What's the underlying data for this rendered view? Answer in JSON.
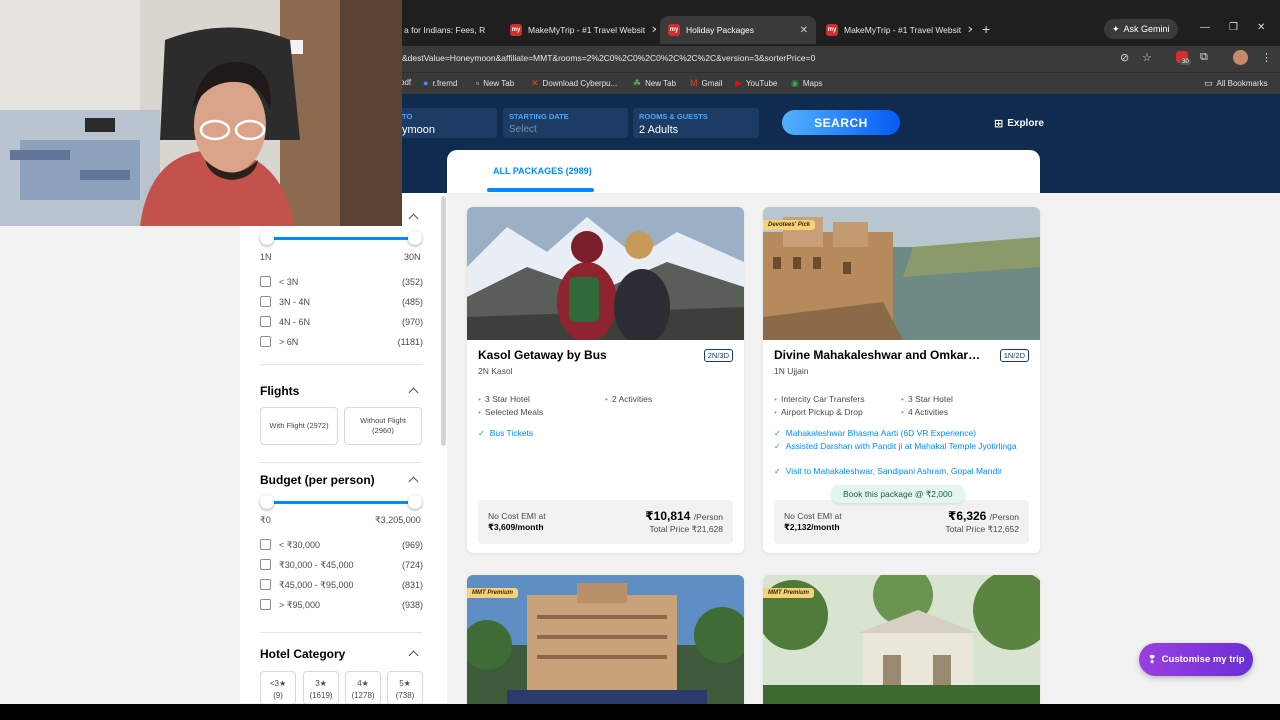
{
  "browser": {
    "tabs": [
      {
        "title": "a for Indians: Fees, R",
        "active": false
      },
      {
        "title": "MakeMyTrip - #1 Travel Websit",
        "active": false
      },
      {
        "title": "Holiday Packages",
        "active": true
      },
      {
        "title": "MakeMyTrip - #1 Travel Websit",
        "active": false
      }
    ],
    "ask_gemini": "Ask Gemini",
    "url": "&destValue=Honeymoon&affiliate=MMT&rooms=2%2C0%2C0%2C0%2C%2C%2C&version=3&sorterPrice=0",
    "bookmarks": [
      "odf",
      "r.fremd",
      "New Tab",
      "Download Cyberpu...",
      "New Tab",
      "Gmail",
      "YouTube",
      "Maps"
    ],
    "all_bookmarks": "All Bookmarks",
    "notif_count": "30"
  },
  "search": {
    "to_label": "TO",
    "to_value": "ymoon",
    "date_label": "STARTING DATE",
    "date_placeholder": "Select",
    "rooms_label": "ROOMS & GUESTS",
    "rooms_value": "2 Adults",
    "search_button": "SEARCH",
    "explore": "Explore"
  },
  "tabs": {
    "all_packages": "ALL PACKAGES (2989)"
  },
  "filters": {
    "duration": {
      "min": "1N",
      "max": "30N",
      "options": [
        {
          "label": "< 3N",
          "count": "(352)"
        },
        {
          "label": "3N - 4N",
          "count": "(485)"
        },
        {
          "label": "4N - 6N",
          "count": "(970)"
        },
        {
          "label": "> 6N",
          "count": "(1181)"
        }
      ]
    },
    "flights": {
      "title": "Flights",
      "with": "With Flight (2972)",
      "without_line1": "Without Flight",
      "without_line2": "(2960)"
    },
    "budget": {
      "title": "Budget (per person)",
      "min": "₹0",
      "max": "₹3,205,000",
      "options": [
        {
          "label": "< ₹30,000",
          "count": "(969)"
        },
        {
          "label": "₹30,000 - ₹45,000",
          "count": "(724)"
        },
        {
          "label": "₹45,000 - ₹95,000",
          "count": "(831)"
        },
        {
          "label": "> ₹95,000",
          "count": "(938)"
        }
      ]
    },
    "hotel_category": {
      "title": "Hotel Category",
      "options": [
        {
          "stars": "<3★",
          "count": "(9)"
        },
        {
          "stars": "3★",
          "count": "(1619)"
        },
        {
          "stars": "4★",
          "count": "(1278)"
        },
        {
          "stars": "5★",
          "count": "(738)"
        }
      ]
    }
  },
  "packages": [
    {
      "title": "Kasol Getaway by Bus",
      "duration": "2N/3D",
      "destinations": "2N Kasol",
      "features": [
        "3 Star Hotel",
        "2 Activities",
        "Selected Meals"
      ],
      "highlights": [
        "Bus Tickets"
      ],
      "emi_label": "No Cost EMI at",
      "emi_value": "₹3,609/month",
      "price": "₹10,814",
      "per": "/Person",
      "total": "Total Price ₹21,628"
    },
    {
      "title": "Divine Mahakaleshwar and Omkares...",
      "duration": "1N/2D",
      "destinations": "1N Ujjain",
      "badge": "Devotees' Pick",
      "features": [
        "Intercity Car Transfers",
        "3 Star Hotel",
        "Airport Pickup & Drop",
        "4 Activities"
      ],
      "highlights": [
        "Mahakaleshwar Bhasma Aarti (6D VR Experience)",
        "Assisted Darshan with Pandit ji at Mahakal Temple Jyotirlinga",
        "Visit to Mahakaleshwar, Sandipani Ashram, Gopal Mandir"
      ],
      "book_pill": "Book this package @ ₹2,000",
      "emi_label": "No Cost EMI at",
      "emi_value": "₹2,132/month",
      "price": "₹6,326",
      "per": "/Person",
      "total": "Total Price ₹12,652"
    },
    {
      "badge": "MMT Premium"
    },
    {
      "badge": "MMT Premium"
    }
  ],
  "customise": "Customise my trip",
  "colors": {
    "brand_blue": "#008cff",
    "header_navy": "#0f2b4d",
    "customise_purple": "#7b35dc"
  }
}
